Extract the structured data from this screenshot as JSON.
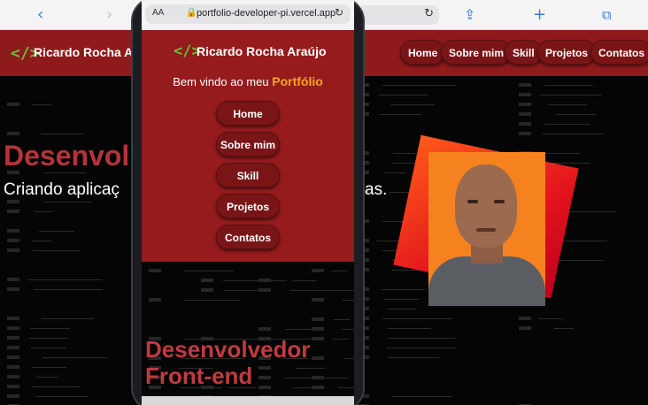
{
  "browser": {
    "back_icon": "chevron-left-icon",
    "forward_icon": "chevron-right-icon",
    "share_icon": "share-icon",
    "new_tab_icon": "plus-icon",
    "tabs_icon": "tabs-icon",
    "reload_icon": "reload-icon"
  },
  "desktop_site": {
    "logo_glyph": "</>",
    "name": "Ricardo Rocha Ara",
    "nav": [
      "Home",
      "Sobre mim",
      "Skill",
      "Projetos",
      "Contatos"
    ],
    "hero_title": "Desenvol",
    "hero_subtitle": "Criando aplicaç",
    "hero_subtitle_end": "as."
  },
  "mobile_site": {
    "url_aa": "AA",
    "url": "portfolio-developer-pi.vercel.app",
    "logo_glyph": "</>",
    "name": "Ricardo Rocha Araújo",
    "welcome": "Bem vindo ao meu",
    "welcome_highlight": "Portfólio",
    "nav": [
      "Home",
      "Sobre mim",
      "Skill",
      "Projetos",
      "Contatos"
    ],
    "hero_line1": "Desenvolvedor",
    "hero_line2": "Front-end"
  },
  "colors": {
    "nav_red": "#951b1d",
    "button_red": "#7a1517",
    "accent_orange": "#f5a623",
    "logo_green": "#6bbf3a",
    "hero_red": "#c03a40"
  }
}
